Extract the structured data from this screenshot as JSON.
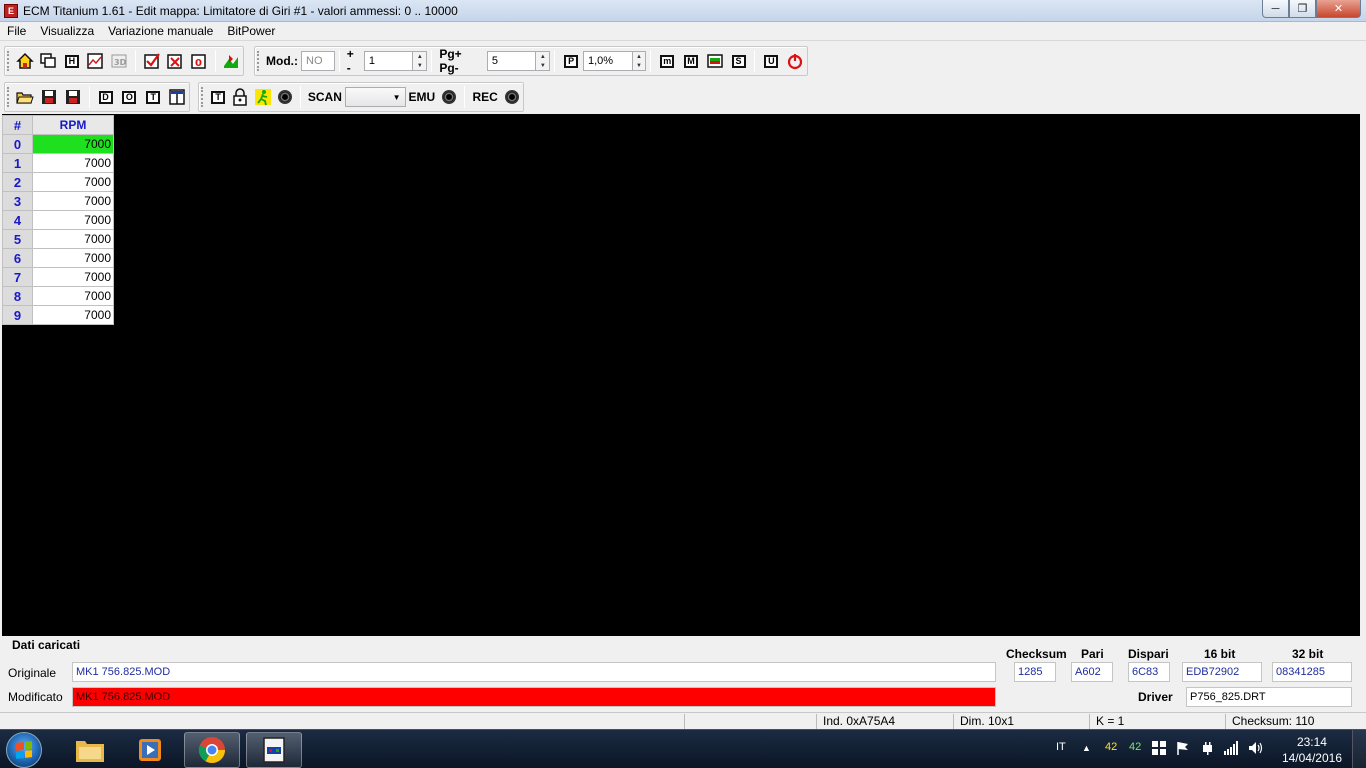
{
  "window": {
    "title": "ECM Titanium 1.61 - Edit mappa: Limitatore di Giri #1 - valori ammessi: 0 .. 10000",
    "app_icon_letter": "E"
  },
  "menu": [
    "File",
    "Visualizza",
    "Variazione manuale",
    "BitPower"
  ],
  "toolbar1": {
    "mod_label": "Mod.:",
    "mod_value": "NO",
    "plusminus_label": "+ -",
    "plusminus_value": "1",
    "pg_label": "Pg+ Pg-",
    "pg_value": "5",
    "percent_value": "1,0%"
  },
  "toolbar2": {
    "scan_label": "SCAN",
    "scan_value": "",
    "emu_label": "EMU",
    "rec_label": "REC"
  },
  "grid": {
    "corner": "#",
    "column_header": "RPM",
    "rows": [
      {
        "index": "0",
        "value": "7000"
      },
      {
        "index": "1",
        "value": "7000"
      },
      {
        "index": "2",
        "value": "7000"
      },
      {
        "index": "3",
        "value": "7000"
      },
      {
        "index": "4",
        "value": "7000"
      },
      {
        "index": "5",
        "value": "7000"
      },
      {
        "index": "6",
        "value": "7000"
      },
      {
        "index": "7",
        "value": "7000"
      },
      {
        "index": "8",
        "value": "7000"
      },
      {
        "index": "9",
        "value": "7000"
      }
    ]
  },
  "info": {
    "section_title": "Dati caricati",
    "originale_label": "Originale",
    "originale_value": "MK1 756.825.MOD",
    "modificato_label": "Modificato",
    "modificato_value": "MK1 756.825.MOD",
    "checksum_label": "Checksum",
    "checksum_value": "1285",
    "pari_label": "Pari",
    "pari_value": "A602",
    "dispari_label": "Dispari",
    "dispari_value": "6C83",
    "bit16_label": "16 bit",
    "bit16_value": "EDB72902",
    "bit32_label": "32 bit",
    "bit32_value": "08341285",
    "driver_label": "Driver",
    "driver_value": "P756_825.DRT"
  },
  "status": {
    "ind": "Ind. 0xA75A4",
    "dim": "Dim. 10x1",
    "k": "K = 1",
    "checksum": "Checksum: 110"
  },
  "taskbar": {
    "language": "IT",
    "tray_num1": "42",
    "tray_num2": "42",
    "time": "23:14",
    "date": "14/04/2016"
  }
}
